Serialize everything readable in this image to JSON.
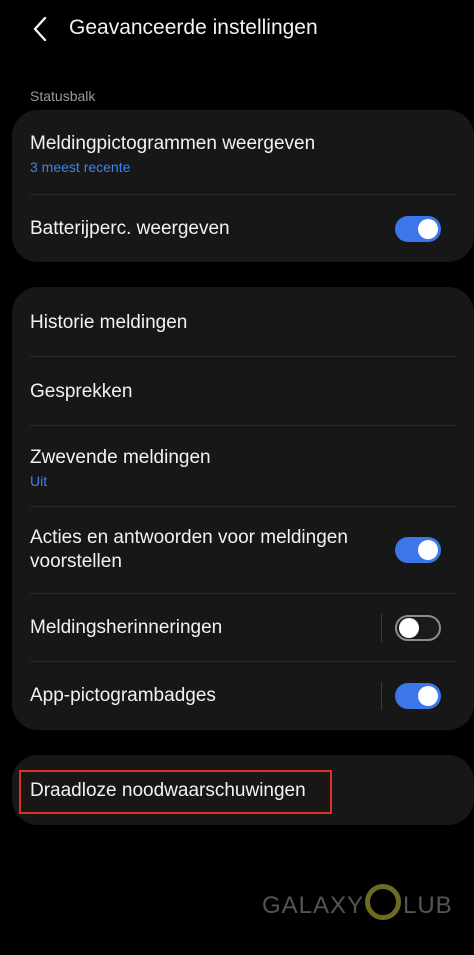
{
  "header": {
    "title": "Geavanceerde instellingen"
  },
  "statusbar": {
    "label": "Statusbalk",
    "items": [
      {
        "label": "Meldingpictogrammen weergeven",
        "sub": "3 meest recente"
      },
      {
        "label": "Batterijperc. weergeven",
        "toggle": true
      }
    ]
  },
  "notifications": {
    "items": [
      {
        "label": "Historie meldingen"
      },
      {
        "label": "Gesprekken"
      },
      {
        "label": "Zwevende meldingen",
        "sub": "Uit"
      },
      {
        "label_line1": "Acties en antwoorden voor meldingen",
        "label_line2": "voorstellen",
        "toggle": true
      },
      {
        "label": "Meldingsherinneringen",
        "toggle": false
      },
      {
        "label": "App-pictogrambadges",
        "toggle": true
      }
    ]
  },
  "wireless": {
    "label": "Draadloze noodwaarschuwingen"
  },
  "watermark": {
    "text": "GALAXY",
    "text2": "LUB"
  },
  "colors": {
    "accent": "#3b77e8",
    "highlight": "#e0302c",
    "card": "#171717"
  }
}
